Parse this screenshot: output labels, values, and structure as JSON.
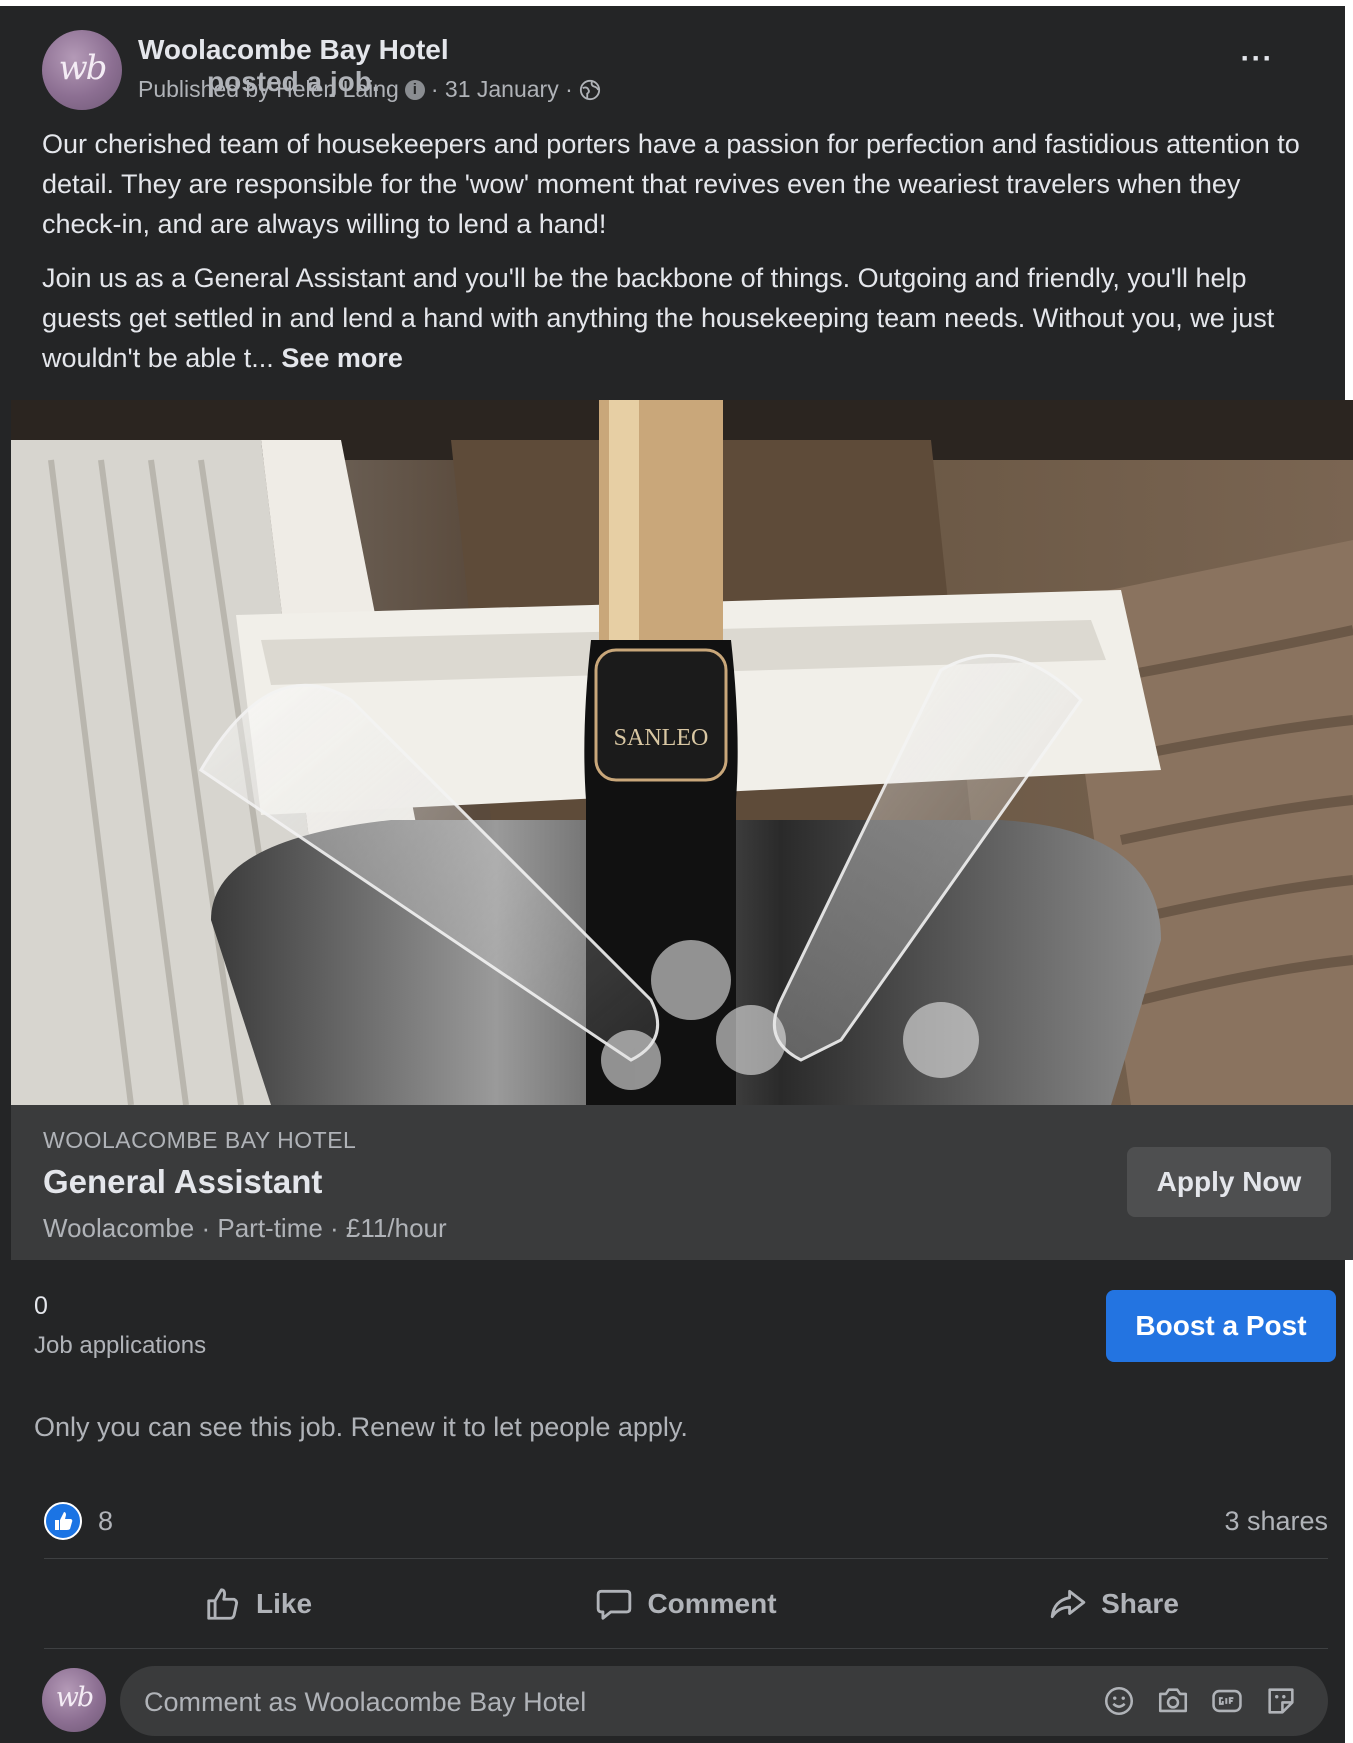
{
  "post": {
    "page_name": "Woolacombe Bay Hotel",
    "action_text": " posted a job.",
    "avatar_monogram": "wb",
    "publisher": "Published by Helen Laing",
    "info_icon": "i",
    "date": "· 31 January ·",
    "more_label": "···",
    "paragraph_1": "Our cherished team of housekeepers and porters have a passion for perfection and fastidious attention to detail. They are responsible for the 'wow' moment that revives even the weariest travelers when they check-in, and are always willing to lend a hand!",
    "paragraph_2": "Join us as a General Assistant and you'll be the backbone of things. Outgoing and friendly, you'll help guests get settled in and lend a hand with anything the housekeeping team needs. Without you, we just wouldn't be able t...",
    "see_more": "See more",
    "photo_label": "SANLEO"
  },
  "job": {
    "company": "WOOLACOMBE BAY HOTEL",
    "title": "General Assistant",
    "meta": "Woolacombe · Part-time · £11/hour",
    "apply_label": "Apply Now"
  },
  "stats": {
    "applications_count": "0",
    "applications_label": "Job applications",
    "boost_label": "Boost a Post",
    "notice": "Only you can see this job. Renew it to let people apply."
  },
  "engagement": {
    "reactions_count": "8",
    "shares": "3 shares"
  },
  "actions": {
    "like": "Like",
    "comment": "Comment",
    "share": "Share"
  },
  "comment_box": {
    "placeholder": "Comment as Woolacombe Bay Hotel"
  },
  "icons": [
    "globe-icon",
    "info-icon",
    "more-icon",
    "like-icon",
    "comment-icon",
    "share-icon",
    "emoji-icon",
    "camera-icon",
    "gif-icon",
    "sticker-icon"
  ],
  "colors": {
    "background": "#242526",
    "card": "#3a3b3c",
    "primary_button": "#2374e1",
    "text_primary": "#e4e6eb",
    "text_secondary": "#b0b3b8"
  }
}
